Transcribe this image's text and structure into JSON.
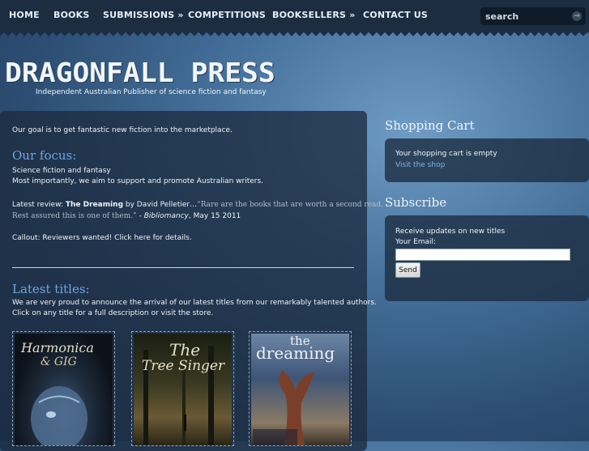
{
  "nav": {
    "items": [
      "HOME",
      "BOOKS",
      "SUBMISSIONS »",
      "COMPETITIONS",
      "BOOKSELLERS »",
      "CONTACT US"
    ],
    "search_placeholder": "search",
    "search_go": "⇒"
  },
  "header": {
    "logo": "DRAGONFALL PRESS",
    "tagline": "Independent Australian Publisher of science fiction and fantasy"
  },
  "main": {
    "intro": "Our goal is to get fantastic new fiction into the marketplace.",
    "focus_heading": "Our focus:",
    "focus_line1": "Science fiction and fantasy",
    "focus_line2": "Most importantly, we aim to support and promote Australian writers.",
    "review_prefix": "Latest review: ",
    "review_title": "The Dreaming",
    "review_by": " by David Pelletier…",
    "review_quote1": "“Rare are the books that are worth a second read.",
    "review_quote2": "Rest assured this is one of them.”",
    "review_dash": " - ",
    "review_source": "Bibliomancy",
    "review_date": ", May 15 2011",
    "callout_prefix": "Callout:  Reviewers wanted!  Click ",
    "callout_link": "here",
    "callout_suffix": " for details.",
    "latest_heading": "Latest titles:",
    "latest_line1": "We are very proud to announce the arrival of our latest titles from our remarkably talented authors.",
    "latest_line2": "Click on any title for a full description or visit the store.",
    "books": [
      {
        "title_line1": "Harmonica",
        "title_line2": "& GIG"
      },
      {
        "title_line1": "The",
        "title_line2": "Tree Singer"
      },
      {
        "title_line1": "the",
        "title_line2": "dreaming"
      }
    ]
  },
  "sidebar": {
    "cart_title": "Shopping Cart",
    "cart_empty": "Your shopping cart is empty",
    "cart_link": "Visit the shop",
    "subscribe_title": "Subscribe",
    "subscribe_text": "Receive updates on new titles",
    "email_label": "Your Email:",
    "send_label": "Send"
  }
}
